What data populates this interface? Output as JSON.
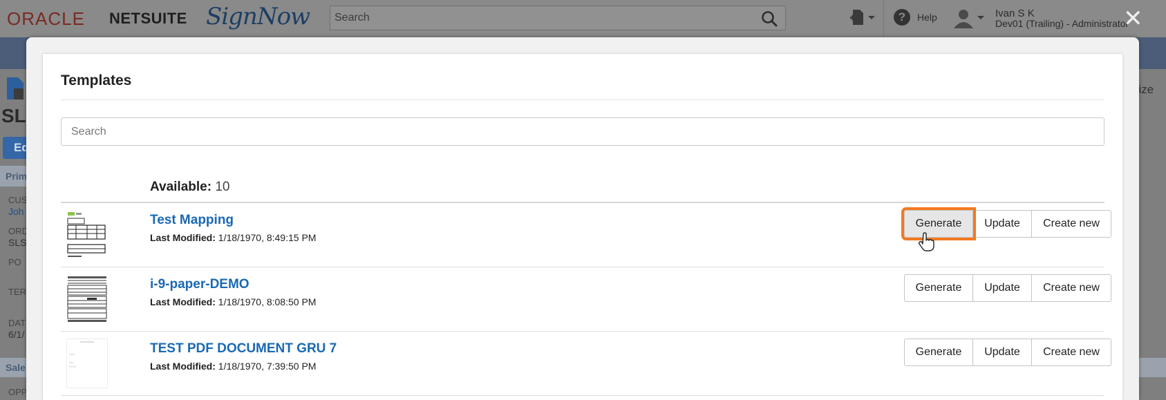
{
  "header": {
    "logo_oracle": "ORACLE",
    "logo_netsuite": "NETSUITE",
    "logo_signnow": "SignNow",
    "search_placeholder": "Search",
    "help_label": "Help",
    "user_name": "Ivan S K",
    "user_role": "Dev01 (Trailing) - Administrator",
    "icons": [
      "search-icon",
      "new-document-icon",
      "help-icon",
      "user-avatar-icon",
      "close-icon"
    ]
  },
  "background": {
    "labels": [
      "SL",
      "Ed",
      "Prim",
      "CUS",
      "Joh",
      "ORD",
      "SLS",
      "PO ",
      "TER",
      "DAT",
      "6/1/",
      "Sale",
      "OPP"
    ],
    "right_label": "nize"
  },
  "modal": {
    "title": "Templates",
    "search_placeholder": "Search",
    "available_label": "Available:",
    "available_count": "10",
    "modified_label": "Last Modified:",
    "buttons": {
      "generate": "Generate",
      "update": "Update",
      "create_new": "Create new"
    },
    "templates": [
      {
        "name": "Test Mapping",
        "last_modified": "1/18/1970, 8:49:15 PM"
      },
      {
        "name": "i-9-paper-DEMO",
        "last_modified": "1/18/1970, 8:08:50 PM"
      },
      {
        "name": "TEST PDF DOCUMENT GRU 7",
        "last_modified": "1/18/1970, 7:39:50 PM"
      }
    ],
    "highlight_color": "#f37a20",
    "link_color": "#1a68b3"
  }
}
